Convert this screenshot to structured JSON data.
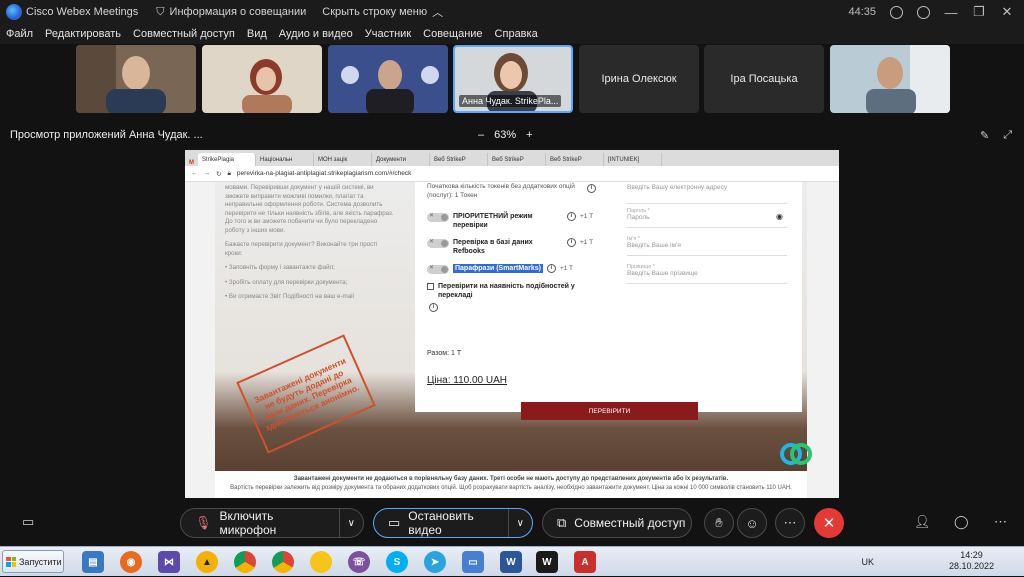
{
  "window": {
    "app_title": "Cisco Webex Meetings",
    "meeting_info": "Информация о совещании",
    "hide_menu": "Скрыть строку меню",
    "timer": "44:35"
  },
  "menu": [
    "Файл",
    "Редактировать",
    "Совместный доступ",
    "Вид",
    "Аудио и видео",
    "Участник",
    "Совещание",
    "Справка"
  ],
  "participants": [
    {
      "name": "",
      "kind": "video",
      "bg": "#6d5a48"
    },
    {
      "name": "",
      "kind": "video",
      "bg": "#c8b8a4"
    },
    {
      "name": "",
      "kind": "video",
      "bg": "#3c4e86"
    },
    {
      "name": "Анна Чудак. StrikePla...",
      "kind": "video-active",
      "bg": "#cfd3d8"
    },
    {
      "name": "Ірина Олексюк",
      "kind": "name",
      "bg": "#2b2b2b"
    },
    {
      "name": "Іра Посацька",
      "kind": "name",
      "bg": "#2b2b2b"
    },
    {
      "name": "",
      "kind": "video",
      "bg": "#9cb8c8"
    }
  ],
  "share": {
    "title": "Просмотр приложений Анна Чудак. ...",
    "zoom": "63%",
    "minus": "–",
    "plus": "+"
  },
  "browser": {
    "tabs": [
      "StrikePlagia",
      "Національн",
      "МОН зацік",
      "Документи",
      "Веб StrikeP",
      "Веб StrikeP",
      "Веб StrikeP",
      "[INTUNIEK]"
    ],
    "url": "perevirka-na-plagiat-antiplagiat.strikeplagiarism.com/#/check"
  },
  "page": {
    "left_para1": "мовами. Перевіривши документ у нашій системі, ви зможете виправити можливі помилки, плагіат та неправильне оформлення роботи. Система дозволить перевірити не тільки наявність збігів, але якість парафраз. До того ж ви зможете побачити чи було перекладено роботу з інших мови.",
    "left_para2": "Бажаєте перевірити документ? Виконайте три прості кроки:",
    "left_list": [
      "Заповніть форму і завантажте файл;",
      "Зробіть оплату для перевірки документа;",
      "Ви отримаєте Звіт Подібності на ваш e-mail"
    ],
    "stamp": "Завантажені документи не будуть додані до бази даних. Перевірка здійснюється анонімно.",
    "initial_tokens": "Початкова кількість токенів без додаткових опцій (послуг): 1 Токен",
    "options": [
      {
        "label": "ПРІОРИТЕТНИЙ режим перевірки",
        "add": "+1 T"
      },
      {
        "label": "Перевірка в базі даних Refbooks",
        "add": "+1 T"
      },
      {
        "label": "Парафрази (SmartMarks)",
        "add": "+1 T"
      }
    ],
    "translation_check": "Перевірити на наявність подібностей у перекладі",
    "total": "Разом: 1 T",
    "price": "Ціна: 110.00 UAH",
    "submit": "ПЕРЕВІРИТИ",
    "email_placeholder": "Введіть Вашу електронну адресу",
    "password_label": "Пароль *",
    "password_placeholder": "Пароль",
    "name_label": "Ім'я *",
    "name_placeholder": "Введіть Ваше ім'я",
    "surname_label": "Прізвище *",
    "surname_placeholder": "Введіть Ваше прізвище",
    "footer_bold": "Завантажені документи не додаються в порівняльну базу даних. Треті особи не мають доступу до представлених документів або їх результатів.",
    "footer_small": "Вартість перевірки залежить від розміру документа та обраних додаткових опцій. Щоб розрахувати вартість аналізу, необхідно завантажити документ. Ціна за кожні 10 000 символів становить 110 UAH."
  },
  "controls": {
    "mic": "Включить микрофон",
    "video": "Остановить видео",
    "share": "Совместный доступ"
  },
  "taskbar": {
    "start": "Запустити",
    "lang": "UK",
    "time": "14:29",
    "date": "28.10.2022"
  }
}
